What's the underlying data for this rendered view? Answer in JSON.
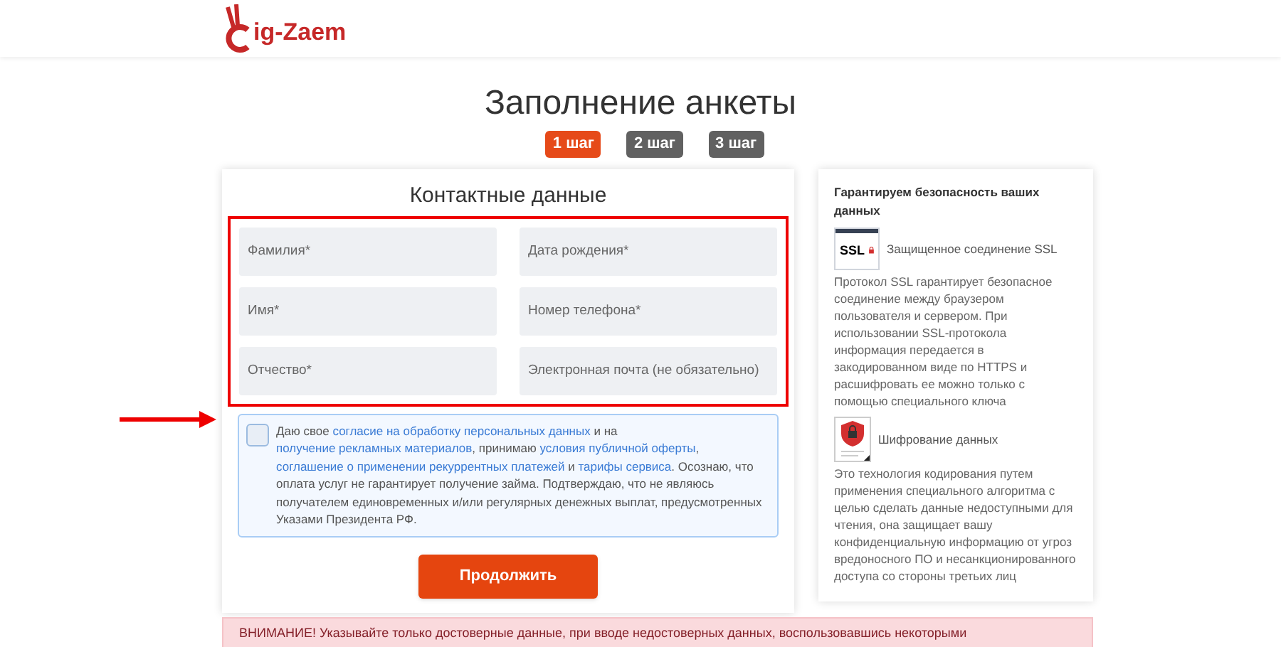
{
  "header": {
    "logo_text": "ig-Zaem"
  },
  "title": "Заполнение анкеты",
  "steps": [
    {
      "label": "1 шаг",
      "selected": true
    },
    {
      "label": "2 шаг",
      "selected": false
    },
    {
      "label": "3 шаг",
      "selected": false
    }
  ],
  "form": {
    "heading": "Контактные данные",
    "fields": [
      {
        "placeholder": "Фамилия*"
      },
      {
        "placeholder": "Дата рождения*"
      },
      {
        "placeholder": "Имя*"
      },
      {
        "placeholder": "Номер телефона*"
      },
      {
        "placeholder": "Отчество*"
      },
      {
        "placeholder": "Электронная почта (не обязательно)"
      }
    ],
    "consent": {
      "checked": false,
      "segments": [
        {
          "kind": "text",
          "text": "Даю свое "
        },
        {
          "kind": "link",
          "text": "согласие на обработку персональных данных"
        },
        {
          "kind": "text",
          "text": " и на "
        },
        {
          "kind": "link",
          "text": "получение рекламных материалов"
        },
        {
          "kind": "text",
          "text": ", принимаю "
        },
        {
          "kind": "link",
          "text": "условия публичной оферты"
        },
        {
          "kind": "text",
          "text": ", "
        },
        {
          "kind": "link",
          "text": "соглашение о применении рекуррентных платежей"
        },
        {
          "kind": "text",
          "text": " и "
        },
        {
          "kind": "link",
          "text": "тарифы сервиса"
        },
        {
          "kind": "text",
          "text": ". Осознаю, что оплата услуг не гарантирует получение займа. Подтверждаю, что не являюсь получателем единовременных и/или регулярных денежных выплат, предусмотренных Указами Президента РФ."
        }
      ]
    },
    "submit": "Продолжить"
  },
  "security": {
    "heading": "Гарантируем безопасность ваших данных",
    "items": [
      {
        "kind": "ssl",
        "badge": "SSL",
        "title": "Защищенное соединение SSL",
        "text": "Протокол SSL гарантирует безопасное соединение между браузером пользователя и сервером. При использовании SSL-протокола информация передается в закодированном виде по HTTPS и расшифровать ее можно только с помощью специального ключа"
      },
      {
        "kind": "encryption",
        "title": "Шифрование данных",
        "text": "Это технология кодирования путем применения специального алгоритма с целью сделать данные недоступными для чтения, она защищает вашу конфиденциальную информацию от угроз вредоносного ПО и несанкционированного доступа со стороны третьих лиц"
      }
    ]
  },
  "warning": "ВНИМАНИЕ! Указывайте только достоверные данные, при вводе недостоверных данных, воспользовавшись некоторыми"
}
